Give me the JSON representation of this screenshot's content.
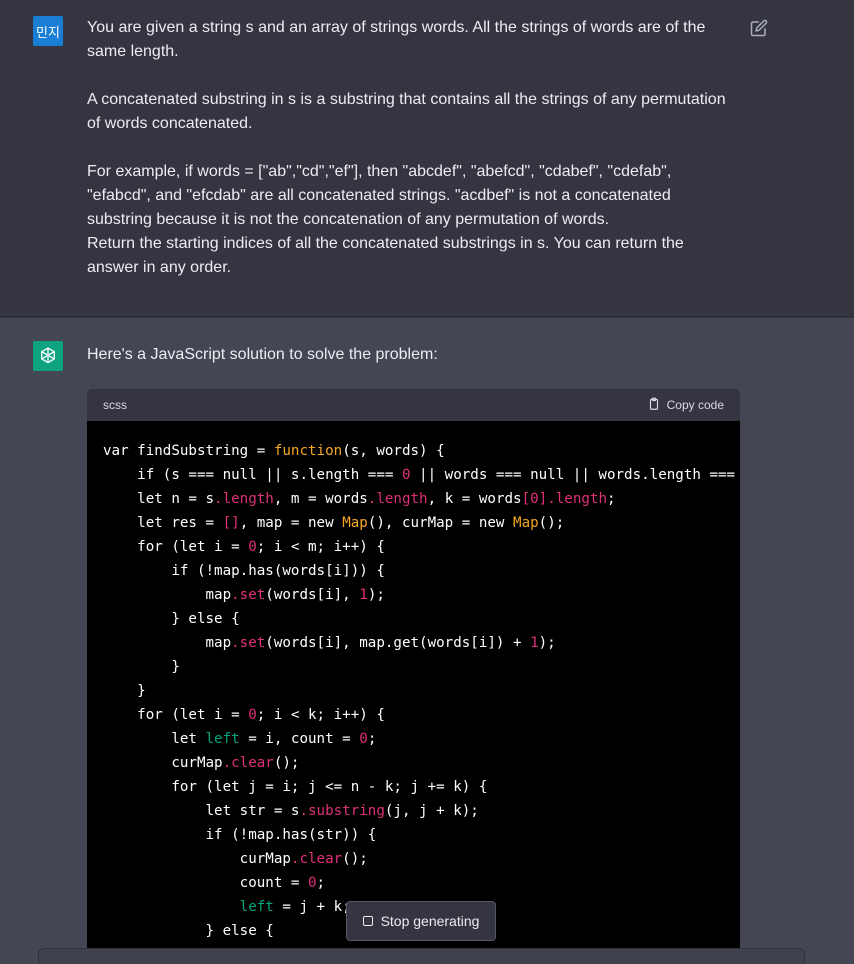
{
  "user": {
    "avatar_label": "민지",
    "paragraphs": [
      "You are given a string s and an array of strings words. All the strings of words are of the same length.",
      "A concatenated substring in s is a substring that contains all the strings of any permutation of words concatenated.",
      "For example, if words = [\"ab\",\"cd\",\"ef\"], then \"abcdef\", \"abefcd\", \"cdabef\", \"cdefab\", \"efabcd\", and \"efcdab\" are all concatenated strings. \"acdbef\" is not a concatenated substring because it is not the concatenation of any permutation of words.",
      "Return the starting indices of all the concatenated substrings in s. You can return the answer in any order."
    ]
  },
  "assistant": {
    "intro": "Here's a JavaScript solution to solve the problem:",
    "code_lang": "scss",
    "copy_label": "Copy code",
    "code_lines": [
      [
        [
          "var findSubstring = ",
          "w"
        ],
        [
          "function",
          "o"
        ],
        [
          "(s, words) {",
          "w"
        ]
      ],
      [
        [
          "    if (s === null || s.length === ",
          "w"
        ],
        [
          "0",
          "r"
        ],
        [
          " || words === null || words.length === ",
          "w"
        ],
        [
          "0",
          "r"
        ]
      ],
      [
        [
          "    let n = s",
          "w"
        ],
        [
          ".length",
          "r"
        ],
        [
          ", m = words",
          "w"
        ],
        [
          ".length",
          "r"
        ],
        [
          ", k = words",
          "w"
        ],
        [
          "[0]",
          "r"
        ],
        [
          ".length",
          "r"
        ],
        [
          ";",
          "w"
        ]
      ],
      [
        [
          "    let res = ",
          "w"
        ],
        [
          "[]",
          "r"
        ],
        [
          ", map = new ",
          "w"
        ],
        [
          "Map",
          "o"
        ],
        [
          "(), curMap = new ",
          "w"
        ],
        [
          "Map",
          "o"
        ],
        [
          "();",
          "w"
        ]
      ],
      [
        [
          "    for (let i = ",
          "w"
        ],
        [
          "0",
          "r"
        ],
        [
          "; i < m; i++) {",
          "w"
        ]
      ],
      [
        [
          "        if (!map.has(words[i])) {",
          "w"
        ]
      ],
      [
        [
          "            map",
          "w"
        ],
        [
          ".set",
          "r"
        ],
        [
          "(words[i], ",
          "w"
        ],
        [
          "1",
          "r"
        ],
        [
          ");",
          "w"
        ]
      ],
      [
        [
          "        } else {",
          "w"
        ]
      ],
      [
        [
          "            map",
          "w"
        ],
        [
          ".set",
          "r"
        ],
        [
          "(words[i], map.get(words[i]) + ",
          "w"
        ],
        [
          "1",
          "r"
        ],
        [
          ");",
          "w"
        ]
      ],
      [
        [
          "        }",
          "w"
        ]
      ],
      [
        [
          "    }",
          "w"
        ]
      ],
      [
        [
          "    for (let i = ",
          "w"
        ],
        [
          "0",
          "r"
        ],
        [
          "; i < k; i++) {",
          "w"
        ]
      ],
      [
        [
          "        let ",
          "w"
        ],
        [
          "left",
          "g"
        ],
        [
          " = i, count = ",
          "w"
        ],
        [
          "0",
          "r"
        ],
        [
          ";",
          "w"
        ]
      ],
      [
        [
          "        curMap",
          "w"
        ],
        [
          ".clear",
          "r"
        ],
        [
          "();",
          "w"
        ]
      ],
      [
        [
          "        for (let j = i; j <= n - k; j += k) {",
          "w"
        ]
      ],
      [
        [
          "            let str = s",
          "w"
        ],
        [
          ".substring",
          "r"
        ],
        [
          "(j, j + k);",
          "w"
        ]
      ],
      [
        [
          "            if (!map.has(str)) {",
          "w"
        ]
      ],
      [
        [
          "                curMap",
          "w"
        ],
        [
          ".clear",
          "r"
        ],
        [
          "();",
          "w"
        ]
      ],
      [
        [
          "                count = ",
          "w"
        ],
        [
          "0",
          "r"
        ],
        [
          ";",
          "w"
        ]
      ],
      [
        [
          "                ",
          "w"
        ],
        [
          "left",
          "g"
        ],
        [
          " = j + k;",
          "w"
        ]
      ],
      [
        [
          "            } else {",
          "w"
        ]
      ]
    ],
    "stop_label": "Stop generating"
  },
  "colors": {
    "w": "#ffffff",
    "r": "#df3079",
    "o": "#f5a623",
    "g": "#00a67d"
  }
}
